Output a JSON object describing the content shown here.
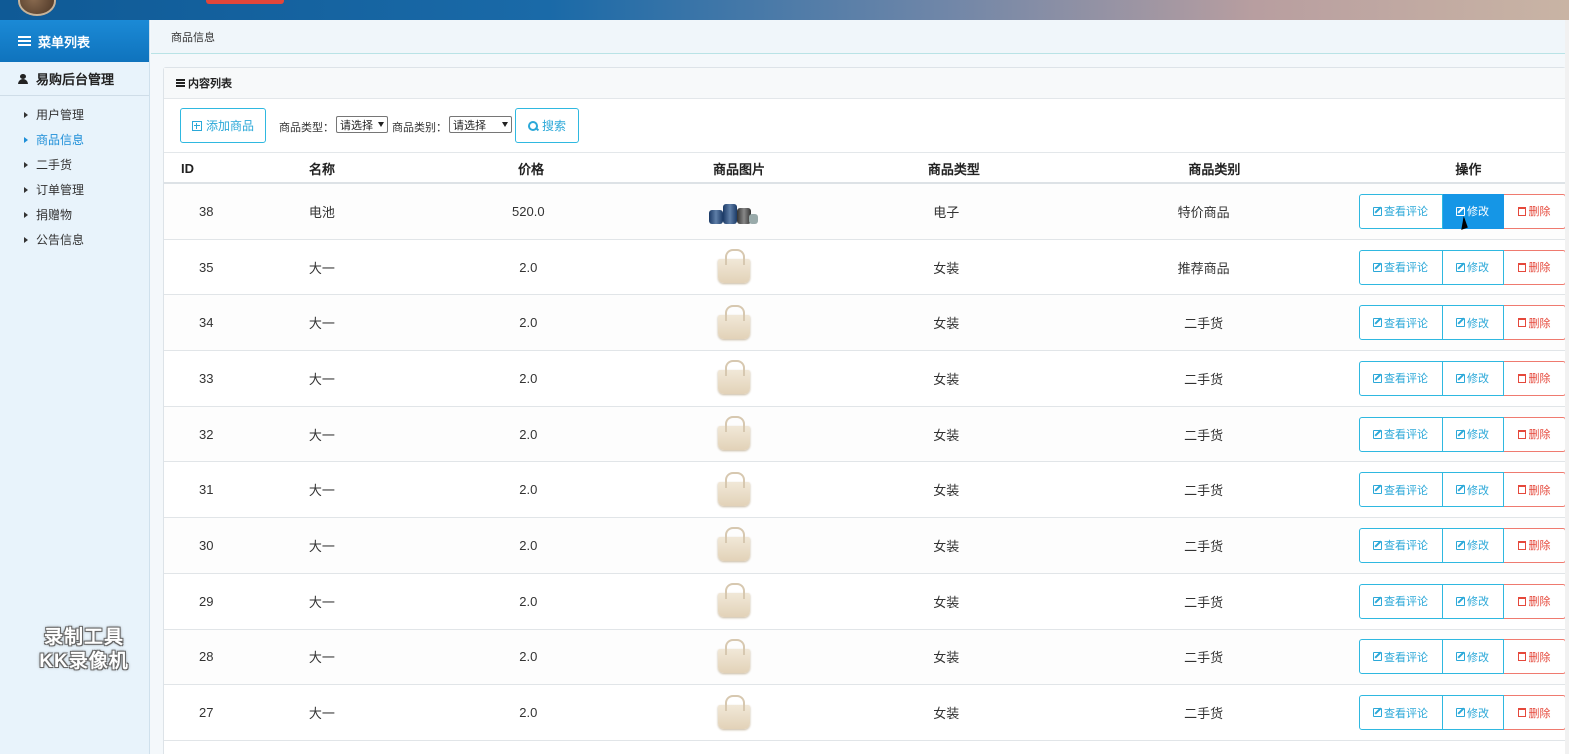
{
  "sidebar": {
    "menu_title": "菜单列表",
    "group_title": "易购后台管理",
    "items": [
      {
        "label": "用户管理",
        "active": false
      },
      {
        "label": "商品信息",
        "active": true
      },
      {
        "label": "二手货",
        "active": false
      },
      {
        "label": "订单管理",
        "active": false
      },
      {
        "label": "捐赠物",
        "active": false
      },
      {
        "label": "公告信息",
        "active": false
      }
    ]
  },
  "watermark": {
    "line1": "录制工具",
    "line2": "KK录像机"
  },
  "breadcrumb": "商品信息",
  "panel": {
    "title": "内容列表"
  },
  "toolbar": {
    "add_label": "添加商品",
    "type_label": "商品类型：",
    "type_value": "请选择",
    "category_label": "商品类别：",
    "category_value": "请选择",
    "search_label": "搜索"
  },
  "table": {
    "headers": {
      "id": "ID",
      "name": "名称",
      "price": "价格",
      "image": "商品图片",
      "type": "商品类型",
      "category": "商品类别",
      "ops": "操作"
    },
    "actions": {
      "view": "查看评论",
      "edit": "修改",
      "delete": "删除"
    },
    "rows": [
      {
        "id": "38",
        "name": "电池",
        "price": "520.0",
        "image": "battery-image",
        "type": "电子",
        "category": "特价商品"
      },
      {
        "id": "35",
        "name": "大一",
        "price": "2.0",
        "image": "bag-image",
        "type": "女装",
        "category": "推荐商品"
      },
      {
        "id": "34",
        "name": "大一",
        "price": "2.0",
        "image": "bag-image",
        "type": "女装",
        "category": "二手货"
      },
      {
        "id": "33",
        "name": "大一",
        "price": "2.0",
        "image": "bag-image",
        "type": "女装",
        "category": "二手货"
      },
      {
        "id": "32",
        "name": "大一",
        "price": "2.0",
        "image": "bag-image",
        "type": "女装",
        "category": "二手货"
      },
      {
        "id": "31",
        "name": "大一",
        "price": "2.0",
        "image": "bag-image",
        "type": "女装",
        "category": "二手货"
      },
      {
        "id": "30",
        "name": "大一",
        "price": "2.0",
        "image": "bag-image",
        "type": "女装",
        "category": "二手货"
      },
      {
        "id": "29",
        "name": "大一",
        "price": "2.0",
        "image": "bag-image",
        "type": "女装",
        "category": "二手货"
      },
      {
        "id": "28",
        "name": "大一",
        "price": "2.0",
        "image": "bag-image",
        "type": "女装",
        "category": "二手货"
      },
      {
        "id": "27",
        "name": "大一",
        "price": "2.0",
        "image": "bag-image",
        "type": "女装",
        "category": "二手货"
      }
    ]
  },
  "colors": {
    "accent": "#1596e6",
    "outline": "#2fb8e0",
    "danger": "#e5483b"
  }
}
